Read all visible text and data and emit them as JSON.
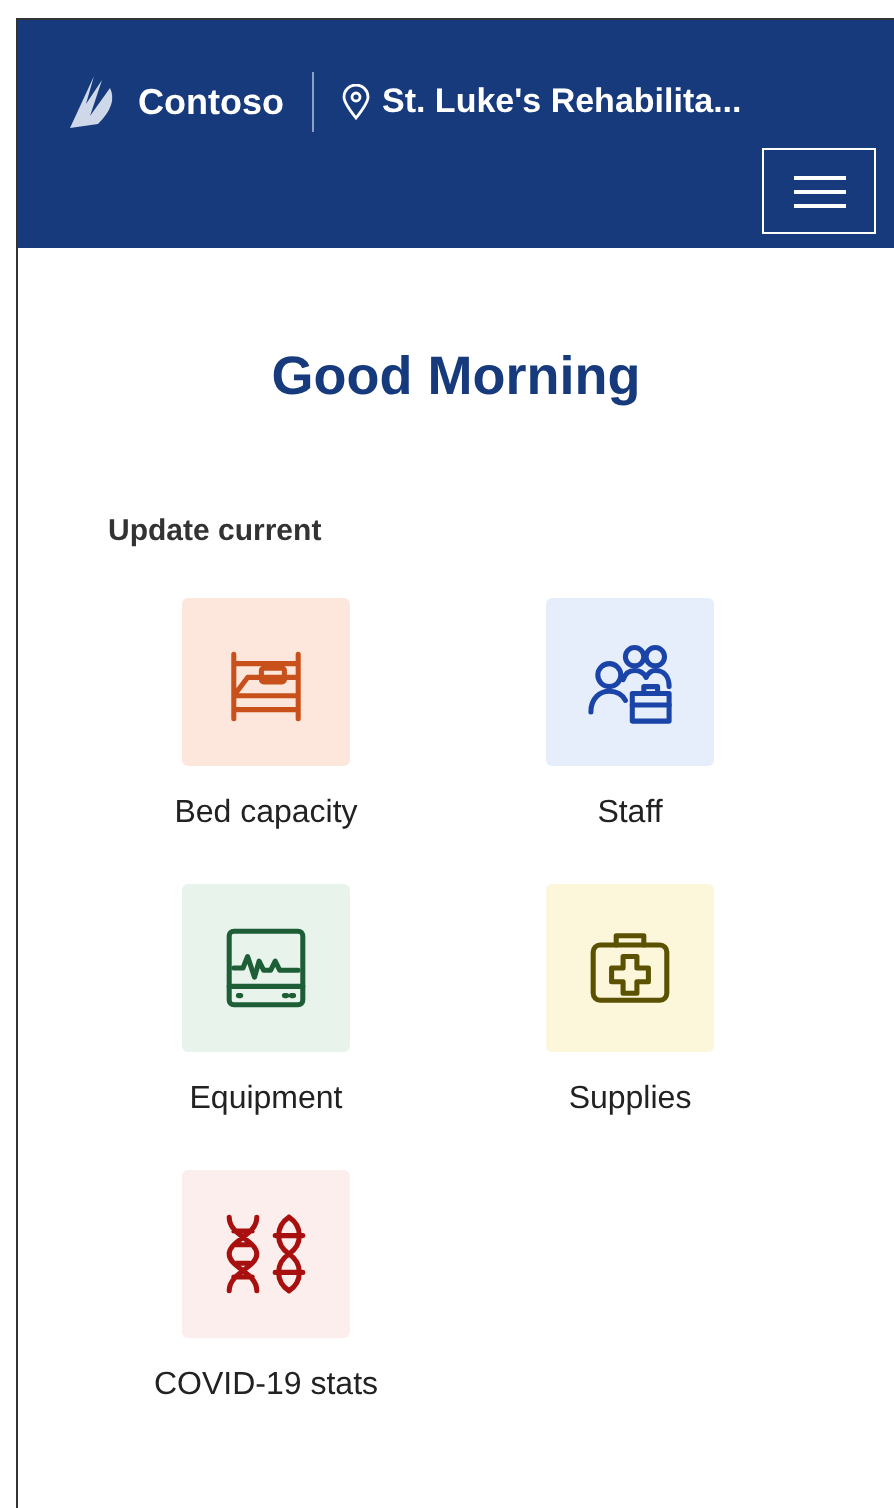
{
  "header": {
    "brand": "Contoso",
    "location": "St. Luke's Rehabilita..."
  },
  "greeting": "Good Morning",
  "section_title": "Update current",
  "tiles": [
    {
      "kind": "bed",
      "label": "Bed capacity",
      "color": "#c8501a"
    },
    {
      "kind": "staff",
      "label": "Staff",
      "color": "#1a44a8"
    },
    {
      "kind": "monitor",
      "label": "Equipment",
      "color": "#1e5e36"
    },
    {
      "kind": "medkit",
      "label": "Supplies",
      "color": "#5a5200"
    },
    {
      "kind": "dna",
      "label": "COVID-19 stats",
      "color": "#a81010"
    }
  ]
}
